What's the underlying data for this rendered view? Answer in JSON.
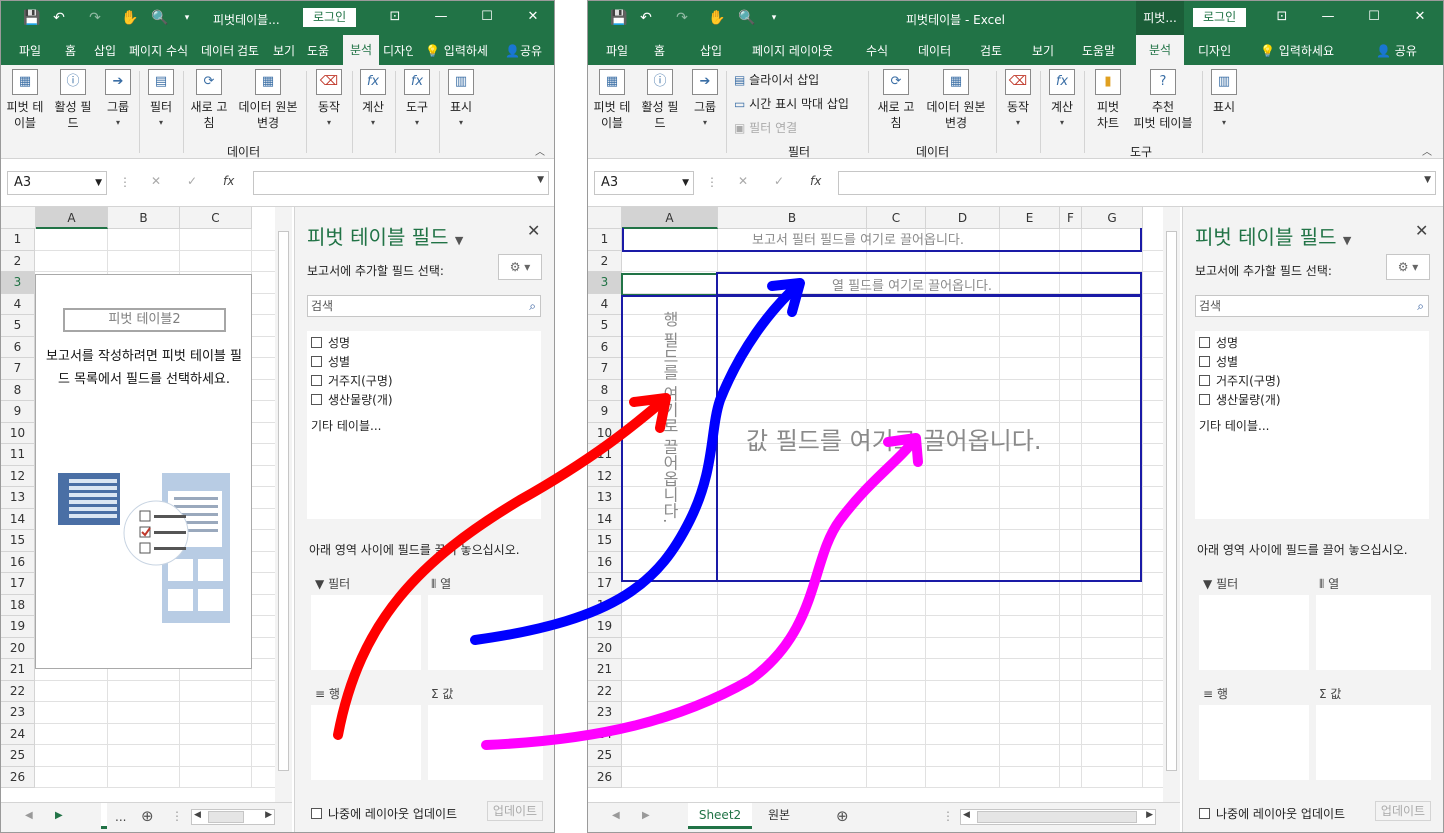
{
  "left": {
    "title": "피벗테이블...",
    "login": "로그인",
    "tabs": [
      "파일",
      "홈",
      "삽입",
      "페이지",
      "수식",
      "데이터",
      "검토",
      "보기",
      "도움",
      "분석",
      "디자인"
    ],
    "tell": "입력하세",
    "share": "공유",
    "ribbon": {
      "pivot": "피벗 테\n이블",
      "active_field": "활성 필\n드",
      "group": "그룹",
      "filter": "필터",
      "refresh": "새로 고\n침",
      "change_source": "데이터 원본\n변경",
      "data_group": "데이터",
      "actions": "동작",
      "calc": "계산",
      "tools": "도구",
      "show": "표시"
    },
    "namebox": "A3",
    "fx": "fx",
    "columns": [
      "A",
      "B",
      "C"
    ],
    "rows": [
      "1",
      "2",
      "3",
      "4",
      "5",
      "6",
      "7",
      "8",
      "9",
      "10",
      "11",
      "12",
      "13",
      "14",
      "15",
      "16",
      "17",
      "18",
      "19",
      "20",
      "21",
      "22",
      "23",
      "24",
      "25",
      "26"
    ],
    "pivot_name": "피벗 테이블2",
    "pivot_instruction": "보고서를 작성하려면 피벗 테이블 필드 목록에서 필드를 선택하세요.",
    "sheet_more": "..."
  },
  "right": {
    "title": "피벗테이블 - Excel",
    "context": "피벗...",
    "login": "로그인",
    "tabs": [
      "파일",
      "홈",
      "삽입",
      "페이지 레이아웃",
      "수식",
      "데이터",
      "검토",
      "보기",
      "도움말",
      "분석",
      "디자인"
    ],
    "tell": "입력하세요",
    "share": "공유",
    "ribbon": {
      "pivot": "피벗 테\n이블",
      "active_field": "활성 필\n드",
      "group": "그룹",
      "slicer": "슬라이서 삽입",
      "timeline": "시간 표시 막대 삽입",
      "filter_conn": "필터 연결",
      "filter_group": "필터",
      "refresh": "새로 고\n침",
      "change_source": "데이터 원본\n변경",
      "data_group": "데이터",
      "actions": "동작",
      "calc": "계산",
      "pivot_chart": "피벗\n차트",
      "recommended": "추천\n피벗 테이블",
      "tools_group": "도구",
      "show": "표시"
    },
    "namebox": "A3",
    "fx": "fx",
    "columns": [
      "A",
      "B",
      "C",
      "D",
      "E",
      "F",
      "G"
    ],
    "rows": [
      "1",
      "2",
      "3",
      "4",
      "5",
      "6",
      "7",
      "8",
      "9",
      "10",
      "11",
      "12",
      "13",
      "14",
      "15",
      "16",
      "17",
      "18",
      "19",
      "20",
      "21",
      "22",
      "23",
      "24",
      "25",
      "26"
    ],
    "drop_filter": "보고서 필터 필드를 여기로 끌어옵니다.",
    "drop_column": "열 필드를 여기로 끌어옵니다.",
    "drop_row": "행 필드를 여기로 끌어옵니다.",
    "drop_value": "값 필드를 여기로 끌어옵니다.",
    "sheets": [
      "Sheet2",
      "원본"
    ]
  },
  "panel": {
    "title": "피벗 테이블 필드",
    "choose": "보고서에 추가할 필드 선택:",
    "search": "검색",
    "fields": [
      "성명",
      "성별",
      "거주지(구명)",
      "생산물량(개)"
    ],
    "more_tables": "기타 테이블...",
    "drag_hint": "아래 영역 사이에 필드를 끌어 놓으십시오.",
    "area_filter": "필터",
    "area_column": "열",
    "area_row": "행",
    "area_value": "값",
    "defer": "나중에 레이아웃 업데이트",
    "update": "업데이트"
  },
  "arrows": {
    "colors": {
      "row": "#ff0000",
      "column": "#0000ff",
      "value": "#ff00ff"
    }
  },
  "colors": {
    "excel_green": "#217346",
    "drop_border": "#1a1aa6"
  }
}
